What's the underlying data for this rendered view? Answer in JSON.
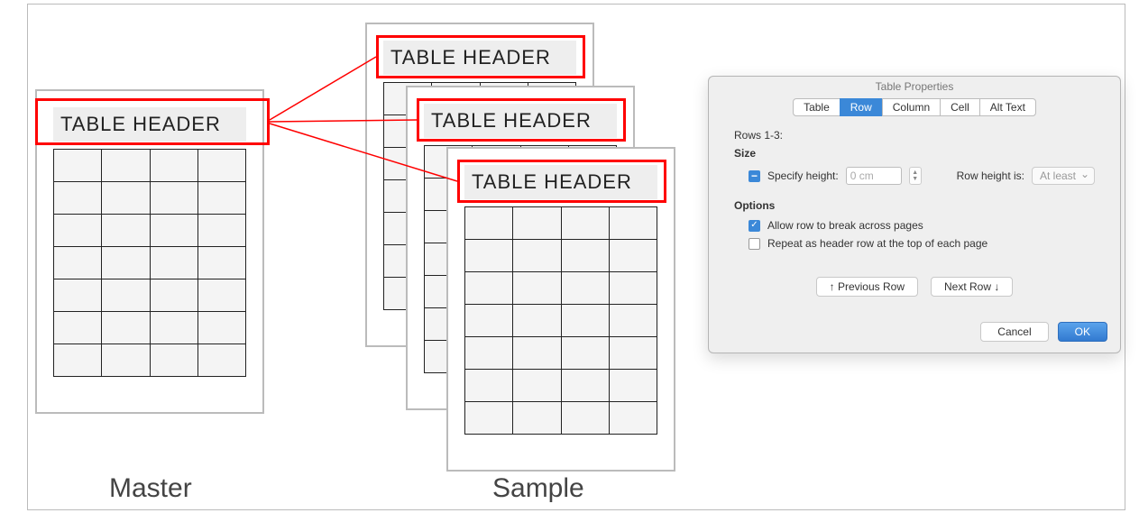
{
  "diagram": {
    "master_label": "Master",
    "sample_label": "Sample",
    "header_text": "TABLE HEADER"
  },
  "dialog": {
    "title": "Table Properties",
    "tabs": {
      "table": "Table",
      "row": "Row",
      "column": "Column",
      "cell": "Cell",
      "alt_text": "Alt Text"
    },
    "rows_label": "Rows 1-3:",
    "size": {
      "title": "Size",
      "specify_height_label": "Specify height:",
      "specify_height_value": "0 cm",
      "row_height_is_label": "Row height is:",
      "row_height_is_value": "At least"
    },
    "options": {
      "title": "Options",
      "allow_break": "Allow row to break across pages",
      "repeat_header": "Repeat as header row at the top of each page"
    },
    "nav": {
      "prev": "↑  Previous Row",
      "next": "Next Row  ↓"
    },
    "footer": {
      "cancel": "Cancel",
      "ok": "OK"
    }
  }
}
